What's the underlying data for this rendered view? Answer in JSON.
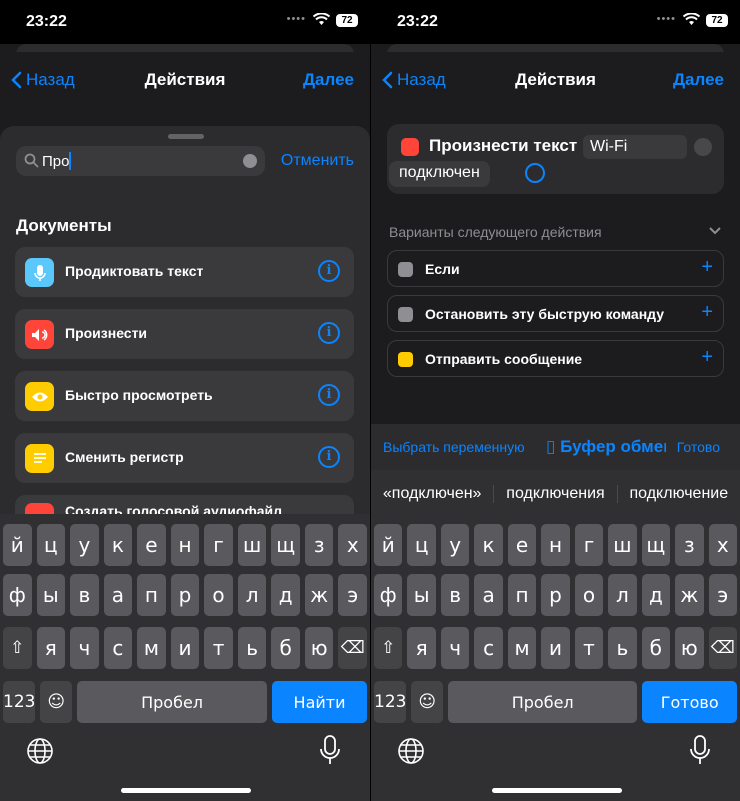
{
  "status": {
    "time": "23:22",
    "battery": "72"
  },
  "nav": {
    "back": "Назад",
    "title": "Действия",
    "next": "Далее"
  },
  "left": {
    "search": {
      "value": "Про",
      "cancel": "Отменить"
    },
    "section_title": "Документы",
    "actions": [
      {
        "label": "Продиктовать текст",
        "icon": "microphone-icon",
        "color": "#5ac8fa"
      },
      {
        "label": "Произнести",
        "icon": "speaker-icon",
        "color": "#ff453a"
      },
      {
        "label": "Быстро просмотреть",
        "icon": "eye-icon",
        "color": "#ffcc00"
      },
      {
        "label": "Сменить регистр",
        "icon": "text-lines-icon",
        "color": "#ffcc00"
      },
      {
        "label": "Создать голосовой аудиофайл",
        "icon": "speaker-icon",
        "color": "#ff453a"
      }
    ],
    "keyboard": {
      "row1": [
        "й",
        "ц",
        "у",
        "к",
        "е",
        "н",
        "г",
        "ш",
        "щ",
        "з",
        "х"
      ],
      "row2": [
        "ф",
        "ы",
        "в",
        "а",
        "п",
        "р",
        "о",
        "л",
        "д",
        "ж",
        "э"
      ],
      "row3": [
        "я",
        "ч",
        "с",
        "м",
        "и",
        "т",
        "ь",
        "б",
        "ю"
      ],
      "numbers": "123",
      "space": "Пробел",
      "action": "Найти"
    }
  },
  "right": {
    "speak": {
      "label": "Произнести текст",
      "token": "Wi-Fi",
      "token2": "подключен"
    },
    "suggestions_title": "Варианты следующего действия",
    "suggestions": [
      {
        "label": "Если",
        "color": "#8e8e93"
      },
      {
        "label": "Остановить эту быструю команду",
        "color": "#8e8e93"
      },
      {
        "label": "Отправить сообщение",
        "color": "#ffcc00"
      }
    ],
    "var_bar": {
      "pick": "Выбрать переменную",
      "clipboard": "Буфер обмена",
      "done": "Готово"
    },
    "predictions": [
      "«подключен»",
      "подключения",
      "подключение"
    ],
    "keyboard": {
      "row1": [
        "й",
        "ц",
        "у",
        "к",
        "е",
        "н",
        "г",
        "ш",
        "щ",
        "з",
        "х"
      ],
      "row2": [
        "ф",
        "ы",
        "в",
        "а",
        "п",
        "р",
        "о",
        "л",
        "д",
        "ж",
        "э"
      ],
      "row3": [
        "я",
        "ч",
        "с",
        "м",
        "и",
        "т",
        "ь",
        "б",
        "ю"
      ],
      "numbers": "123",
      "space": "Пробел",
      "action": "Готово"
    }
  }
}
